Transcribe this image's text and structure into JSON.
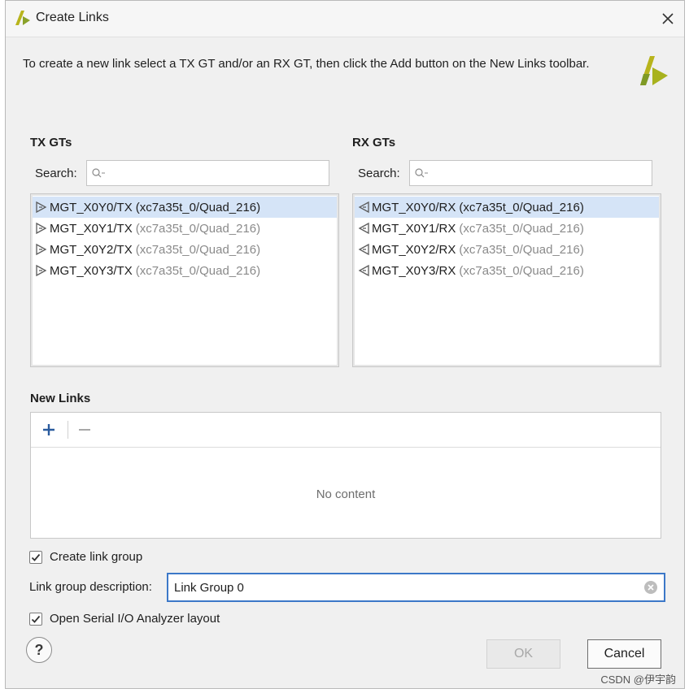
{
  "window": {
    "title": "Create Links",
    "close_icon": "close-icon"
  },
  "intro": "To create a new link select a TX GT and/or an RX GT, then click the Add button on the New Links toolbar.",
  "tx": {
    "heading": "TX GTs",
    "search_label": "Search:",
    "search_value": "",
    "items": [
      {
        "name": "MGT_X0Y0/TX",
        "location": "(xc7a35t_0/Quad_216)",
        "selected": true
      },
      {
        "name": "MGT_X0Y1/TX",
        "location": "(xc7a35t_0/Quad_216)",
        "selected": false
      },
      {
        "name": "MGT_X0Y2/TX",
        "location": "(xc7a35t_0/Quad_216)",
        "selected": false
      },
      {
        "name": "MGT_X0Y3/TX",
        "location": "(xc7a35t_0/Quad_216)",
        "selected": false
      }
    ]
  },
  "rx": {
    "heading": "RX GTs",
    "search_label": "Search:",
    "search_value": "",
    "items": [
      {
        "name": "MGT_X0Y0/RX",
        "location": "(xc7a35t_0/Quad_216)",
        "selected": true
      },
      {
        "name": "MGT_X0Y1/RX",
        "location": "(xc7a35t_0/Quad_216)",
        "selected": false
      },
      {
        "name": "MGT_X0Y2/RX",
        "location": "(xc7a35t_0/Quad_216)",
        "selected": false
      },
      {
        "name": "MGT_X0Y3/RX",
        "location": "(xc7a35t_0/Quad_216)",
        "selected": false
      }
    ]
  },
  "new_links": {
    "heading": "New Links",
    "empty_text": "No content",
    "add_icon": "plus-icon",
    "remove_icon": "minus-icon"
  },
  "options": {
    "create_group_label": "Create link group",
    "create_group_checked": true,
    "group_desc_label": "Link group description:",
    "group_desc_value": "Link Group 0",
    "open_layout_label": "Open Serial I/O Analyzer layout",
    "open_layout_checked": true
  },
  "buttons": {
    "help": "?",
    "ok": "OK",
    "cancel": "Cancel"
  },
  "watermark": "CSDN @伊宇韵",
  "colors": {
    "accent": "#3c78c8",
    "selection": "#d5e4f7",
    "logo_yellow": "#b8b41c",
    "logo_green": "#8aa22a"
  }
}
